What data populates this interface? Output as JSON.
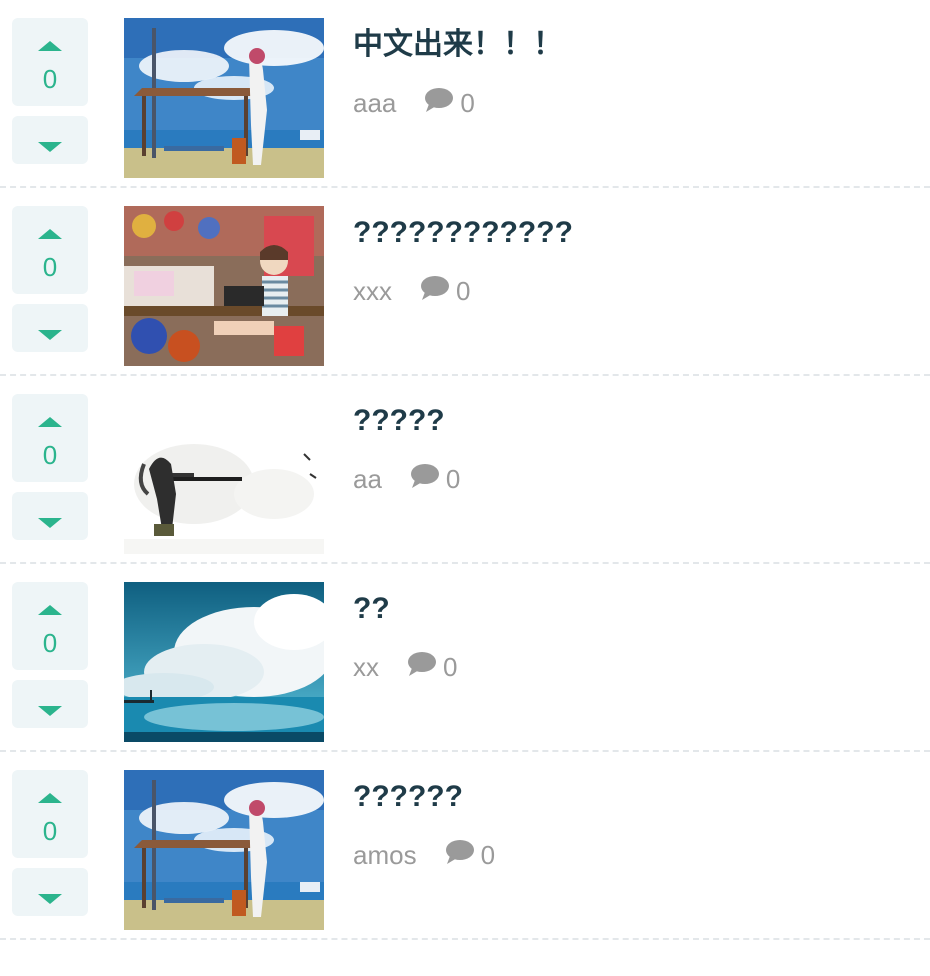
{
  "posts": [
    {
      "score": "0",
      "title": "中文出来！！！",
      "author": "aaa",
      "comments": "0",
      "thumb": "station"
    },
    {
      "score": "0",
      "title": "????????????",
      "author": "xxx",
      "comments": "0",
      "thumb": "room"
    },
    {
      "score": "0",
      "title": "?????",
      "author": "aa",
      "comments": "0",
      "thumb": "sniper"
    },
    {
      "score": "0",
      "title": "??",
      "author": "xx",
      "comments": "0",
      "thumb": "clouds"
    },
    {
      "score": "0",
      "title": "??????",
      "author": "amos",
      "comments": "0",
      "thumb": "station"
    }
  ],
  "icons": {
    "upvote": "triangle-up-icon",
    "downvote": "triangle-down-icon",
    "comment": "speech-bubble-icon"
  },
  "colors": {
    "accent": "#2bb48d",
    "title": "#1f3b48",
    "meta": "#9a9a9a",
    "vote_bg": "#eef5f7"
  }
}
